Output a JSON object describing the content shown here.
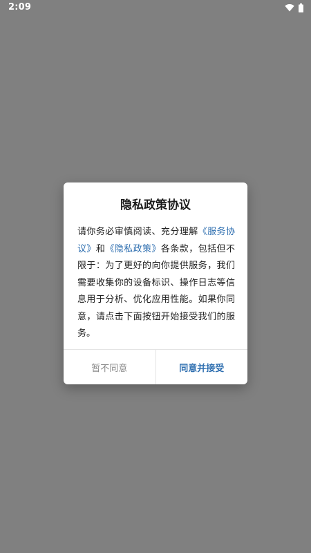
{
  "status_bar": {
    "time": "2:09"
  },
  "dialog": {
    "title": "隐私政策协议",
    "body": {
      "text_1": "请你务必审慎阅读、充分理解",
      "link_service": "《服务协议》",
      "text_2": "和",
      "link_privacy": "《隐私政策》",
      "text_3": "各条款，包括但不限于：为了更好的向你提供服务，我们需要收集你的设备标识、操作日志等信息用于分析、优化应用性能。如果你同意，请点击下面按钮开始接受我们的服务。"
    },
    "buttons": {
      "disagree": "暂不同意",
      "agree": "同意并接受"
    }
  },
  "colors": {
    "overlay": "#808080",
    "link": "#2f6fb0",
    "secondary_text": "#8a8a8a"
  },
  "icons": {
    "wifi": "wifi-icon",
    "battery": "battery-icon"
  }
}
